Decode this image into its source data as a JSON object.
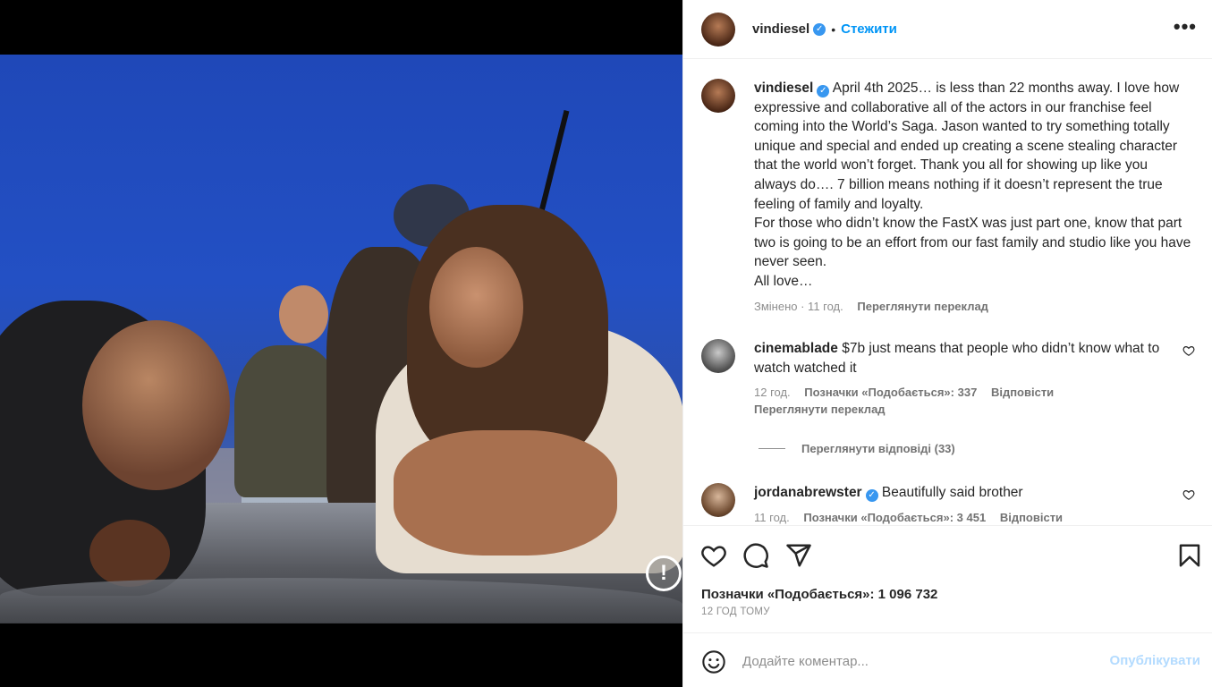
{
  "post": {
    "author": "vindiesel",
    "follow_label": "Стежити",
    "dot": "•",
    "more_glyph": "•••",
    "verified_glyph": "✓",
    "alert_glyph": "!"
  },
  "caption": {
    "author": "vindiesel",
    "text": "April 4th 2025… is less than 22 months away. I love how expressive and collaborative all of the actors in our franchise feel coming into the World’s Saga. Jason wanted to try something totally unique and special and ended up creating a scene stealing character that the world won’t forget. Thank you all for showing up like you always do…. 7 billion means nothing if it doesn’t represent the true feeling of family and loyalty.",
    "text2": "For those who didn’t know the FastX was just part one, know that part two is going to be an effort from our fast family and studio like you have never seen.",
    "text3": "All love…",
    "meta_edited": "Змінено · 11 год.",
    "see_translation": "Переглянути переклад"
  },
  "comments": [
    {
      "author": "cinemablade",
      "text": "$7b just means that people who didn’t know what to watch watched it",
      "time": "12 год.",
      "likes": "Позначки «Подобається»: 337",
      "reply": "Відповісти",
      "see_translation": "Переглянути переклад",
      "view_replies": "Переглянути відповіді (33)"
    },
    {
      "author": "jordanabrewster",
      "text": "Beautifully said brother",
      "time": "11 год.",
      "likes": "Позначки «Подобається»: 3 451",
      "reply": "Відповісти"
    }
  ],
  "actions": {
    "likes_label": "Позначки «Подобається»: 1 096 732",
    "time_ago": "12 ГОД ТОМУ"
  },
  "composer": {
    "placeholder": "Додайте коментар...",
    "publish_label": "Опублікувати"
  },
  "colors": {
    "accent": "#0095f6",
    "verified": "#3897f0",
    "muted": "#8e8e8e",
    "publish_disabled": "#b3dbff"
  },
  "icons": [
    "heart-icon",
    "comment-icon",
    "share-icon",
    "bookmark-icon",
    "emoji-icon",
    "more-icon",
    "verified-icon",
    "alert-icon"
  ]
}
